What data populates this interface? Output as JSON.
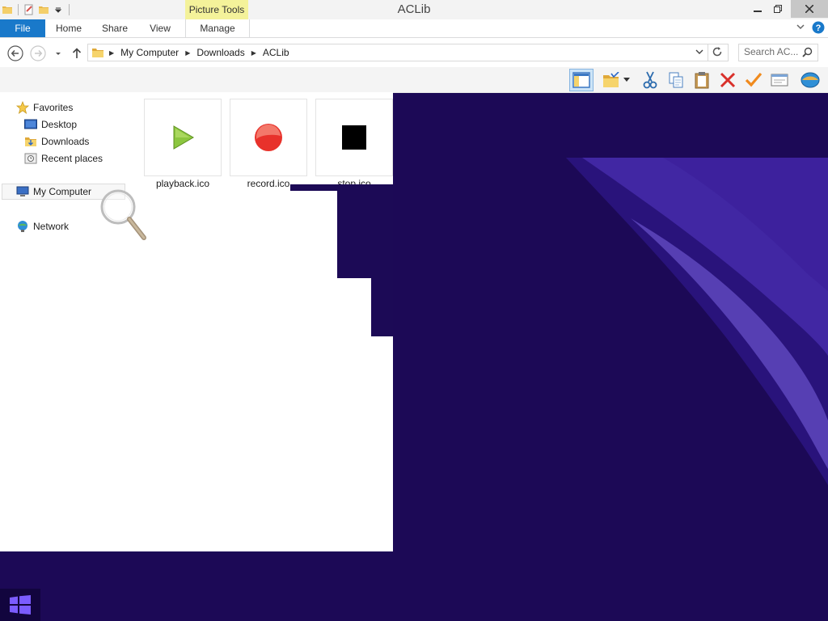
{
  "window": {
    "title": "ACLib"
  },
  "ribbon": {
    "contextual_group": "Picture Tools",
    "tabs": [
      {
        "label": "File"
      },
      {
        "label": "Home"
      },
      {
        "label": "Share"
      },
      {
        "label": "View"
      },
      {
        "label": "Manage"
      }
    ]
  },
  "address": {
    "crumbs": [
      "My Computer",
      "Downloads",
      "ACLib"
    ],
    "search_placeholder": "Search AC..."
  },
  "nav": {
    "favorites": "Favorites",
    "desktop": "Desktop",
    "downloads": "Downloads",
    "recent": "Recent places",
    "my_computer": "My Computer",
    "network": "Network"
  },
  "files": [
    {
      "name": "playback.ico",
      "icon": "play-icon",
      "color": "#8cc63f"
    },
    {
      "name": "record.ico",
      "icon": "record-icon",
      "color": "#e8322b"
    },
    {
      "name": "stop.ico",
      "icon": "stop-icon",
      "color": "#000000"
    }
  ],
  "colors": {
    "accent": "#1979ca",
    "contextual": "#f4f29a",
    "wallpaper": "#1c0956"
  }
}
